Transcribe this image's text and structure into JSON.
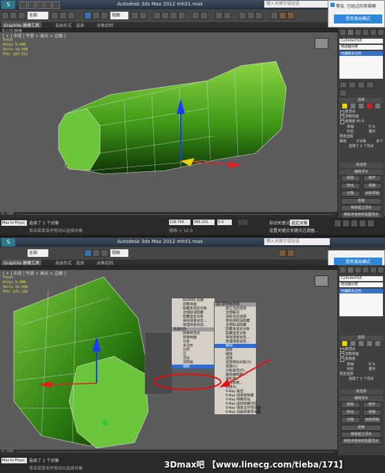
{
  "window": {
    "title": "Autodesk 3ds Max 2012     mh51.max"
  },
  "search": {
    "placeholder": "键入关键字或短语"
  },
  "popup": {
    "text": "警告: 已经过的剪辑模",
    "button": "是否退出模式"
  },
  "toolbar": {
    "selection_filter": "全部",
    "view_dropdown": "视图"
  },
  "ribbon": {
    "tabs": [
      "Graphite 建模工具",
      "自由形式",
      "选择",
      "对象绘制"
    ],
    "sub": "多边形建模"
  },
  "viewport": {
    "label": "[ + ] 中视 | 平滑 + 高光 + 边面 ]",
    "stats_top": [
      "Total",
      "Polys  9,998",
      "Verts  10,598",
      "",
      "FPS:    207.511"
    ],
    "stats_bottom": [
      "Total",
      "Polys  9,998",
      "Verts  10,598",
      "",
      "FPS:    171.243"
    ]
  },
  "command_panel": {
    "object_name": "Cylinder018",
    "modifier_list": "修改器列表",
    "stack_item": "可编辑多边形",
    "selection": {
      "title": "选择",
      "by_vertex": "按顶点",
      "ignore_backfacing": "忽略背面",
      "by_angle": "按角度",
      "angle_value": "45.0",
      "shrink": "收缩",
      "grow": "扩大",
      "ring": "环形",
      "loop": "循环",
      "preview_selection": "预览选择",
      "preview_options": [
        "禁用",
        "子对象",
        "多个"
      ],
      "status": "选择了 1 个顶点"
    },
    "soft_selection": {
      "title": "软选择"
    },
    "edit_vertices": {
      "title": "编辑顶点",
      "buttons": [
        "移除",
        "断开",
        "挤出",
        "焊接",
        "切角",
        "目标焊接",
        "连接",
        "移除孤立顶点",
        "移除未使用的贴图顶点"
      ]
    }
  },
  "timeline": {
    "frame": "0 / 100"
  },
  "status": {
    "maxscript": "Max to Physc",
    "selected": "选择了 1 个对象",
    "hint": "单击或单击并拖动以选择对象",
    "x": "126.764",
    "y": "385.101",
    "z": "0.0",
    "auto_key": "自动关键点",
    "set_key": "设置关键点",
    "key_filters": "关键点过滤器...",
    "selected_dd": "选定对象",
    "grid": "栅格 = 10.0"
  },
  "context_menu_left": {
    "items": [
      "NURMS 切换",
      "忽略背面",
      "隐藏未选定对象",
      "全部取消隐藏",
      "隐藏选定对象",
      "保存场景状态...",
      "管理场景状态...",
      "快速切片",
      "转换到顶点",
      "转换到面",
      "元素",
      "多边形",
      "边界",
      "边",
      "顶点",
      "顶层级"
    ],
    "highlight": "塌陷"
  },
  "context_menu_right": {
    "items": [
      "视口照明和阴影",
      "孤立当前选择",
      "全部解冻",
      "冻结当前选择",
      "按名称取消隐藏",
      "全部取消隐藏",
      "隐藏未选定对象",
      "隐藏选定对象",
      "保存场景状态...",
      "管理场景状态...",
      "移动",
      "旋转",
      "缩放",
      "选择",
      "选择类似对象(S)",
      "克隆(C)",
      "对象属性(P)...",
      "曲线编辑器...",
      "摄影表...",
      "连线参数...",
      "转换为:",
      "V-Ray 属性",
      "V-Ray 场景转换器",
      "V-Ray 网格导出",
      "V-Ray 虚拟帧缓冲区",
      "V-Ray 场景文件导出器",
      "V-Ray 动画场景导出器"
    ],
    "highlight": "移动"
  },
  "watermark": "3Dmax吧 【www.linecg.com/tieba/171】"
}
